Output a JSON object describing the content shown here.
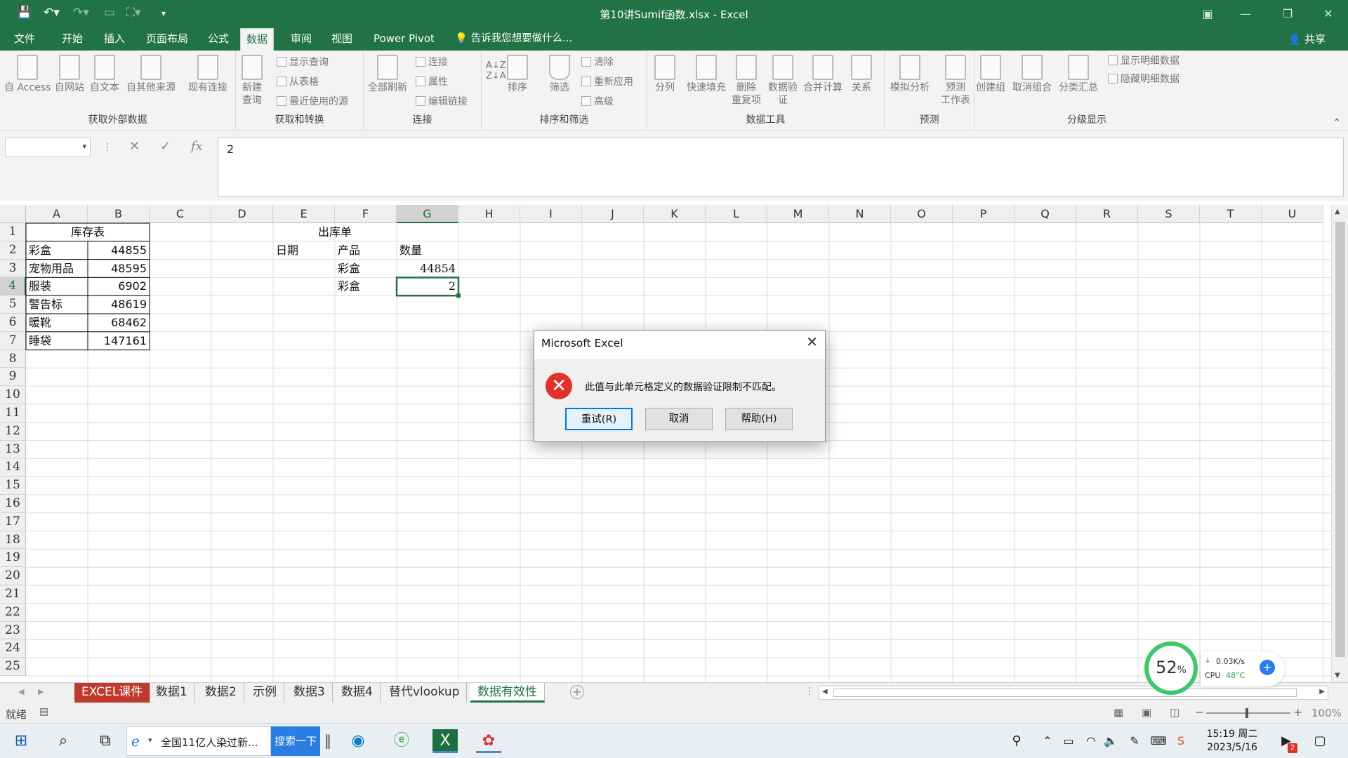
{
  "window": {
    "title": "第10讲Sumif函数.xlsx - Excel",
    "quick_access": [
      "save",
      "undo",
      "redo"
    ]
  },
  "ribbon_tabs": [
    "文件",
    "开始",
    "插入",
    "页面布局",
    "公式",
    "数据",
    "审阅",
    "视图",
    "Power Pivot"
  ],
  "active_tab": "数据",
  "tell_me": "告诉我您想要做什么...",
  "share": "共享",
  "ribbon": {
    "groups": [
      {
        "label": "获取外部数据",
        "buttons": [
          "自 Access",
          "自网站",
          "自文本",
          "自其他来源",
          "现有连接"
        ]
      },
      {
        "label": "获取和转换",
        "big": [
          "新建",
          "查询"
        ],
        "small": [
          "显示查询",
          "从表格",
          "最近使用的源"
        ]
      },
      {
        "label": "连接",
        "big": [
          "全部刷新"
        ],
        "small": [
          "连接",
          "属性",
          "编辑链接"
        ]
      },
      {
        "label": "排序和筛选",
        "big": [
          "排序",
          "筛选"
        ],
        "small": [
          "清除",
          "重新应用",
          "高级"
        ]
      },
      {
        "label": "数据工具",
        "buttons": [
          "分列",
          "快速填充",
          "删除",
          "重复项",
          "数据验",
          "证",
          "合并计算",
          "关系"
        ]
      },
      {
        "label": "预测",
        "buttons": [
          "模拟分析",
          "预测",
          "工作表"
        ]
      },
      {
        "label": "分级显示",
        "buttons": [
          "创建组",
          "取消组合",
          "分类汇总"
        ],
        "small": [
          "显示明细数据",
          "隐藏明细数据"
        ]
      }
    ]
  },
  "formula_bar": {
    "name_box": "",
    "value": "2"
  },
  "columns": [
    "A",
    "B",
    "C",
    "D",
    "E",
    "F",
    "G",
    "H",
    "I",
    "J",
    "K",
    "L",
    "M",
    "N",
    "O",
    "P",
    "Q",
    "R",
    "S",
    "T",
    "U"
  ],
  "selected_column": "G",
  "rows": [
    "1",
    "2",
    "3",
    "4",
    "5",
    "6",
    "7",
    "8",
    "9",
    "10",
    "11",
    "12",
    "13",
    "14",
    "15",
    "16",
    "17",
    "18",
    "19",
    "20",
    "21",
    "22",
    "23",
    "24",
    "25"
  ],
  "selected_row": "4",
  "cells": {
    "A1": "库存表",
    "A2": "彩盒",
    "B2": "44855",
    "A3": "宠物用品",
    "B3": "48595",
    "A4": "服装",
    "B4": "6902",
    "A5": "警告标",
    "B5": "48619",
    "A6": "暖靴",
    "B6": "68462",
    "A7": "睡袋",
    "B7": "147161",
    "E1": "出库单",
    "E2": "日期",
    "F2": "产品",
    "G2": "数量",
    "F3": "彩盒",
    "G3": "44854",
    "F4": "彩盒",
    "G4": "2"
  },
  "sheet_tabs": [
    "EXCEL课件",
    "数据1",
    "数据2",
    "示例",
    "数据3",
    "数据4",
    "替代vlookup",
    "数据有效性"
  ],
  "active_sheet": "数据有效性",
  "status": {
    "mode": "就绪",
    "zoom": "100%"
  },
  "dialog": {
    "title": "Microsoft Excel",
    "message": "此值与此单元格定义的数据验证限制不匹配。",
    "buttons": [
      "重试(R)",
      "取消",
      "帮助(H)"
    ],
    "default_button": "重试(R)"
  },
  "perf_widget": {
    "percent": "52",
    "unit": "%",
    "net": "0.03K/s",
    "cpu_label": "CPU",
    "cpu_temp": "48°C"
  },
  "taskbar": {
    "browser_tab": "全国11亿人染过新...",
    "search_button": "搜索一下",
    "time": "15:19 周二",
    "date": "2023/5/16",
    "notification_badge": "2"
  }
}
